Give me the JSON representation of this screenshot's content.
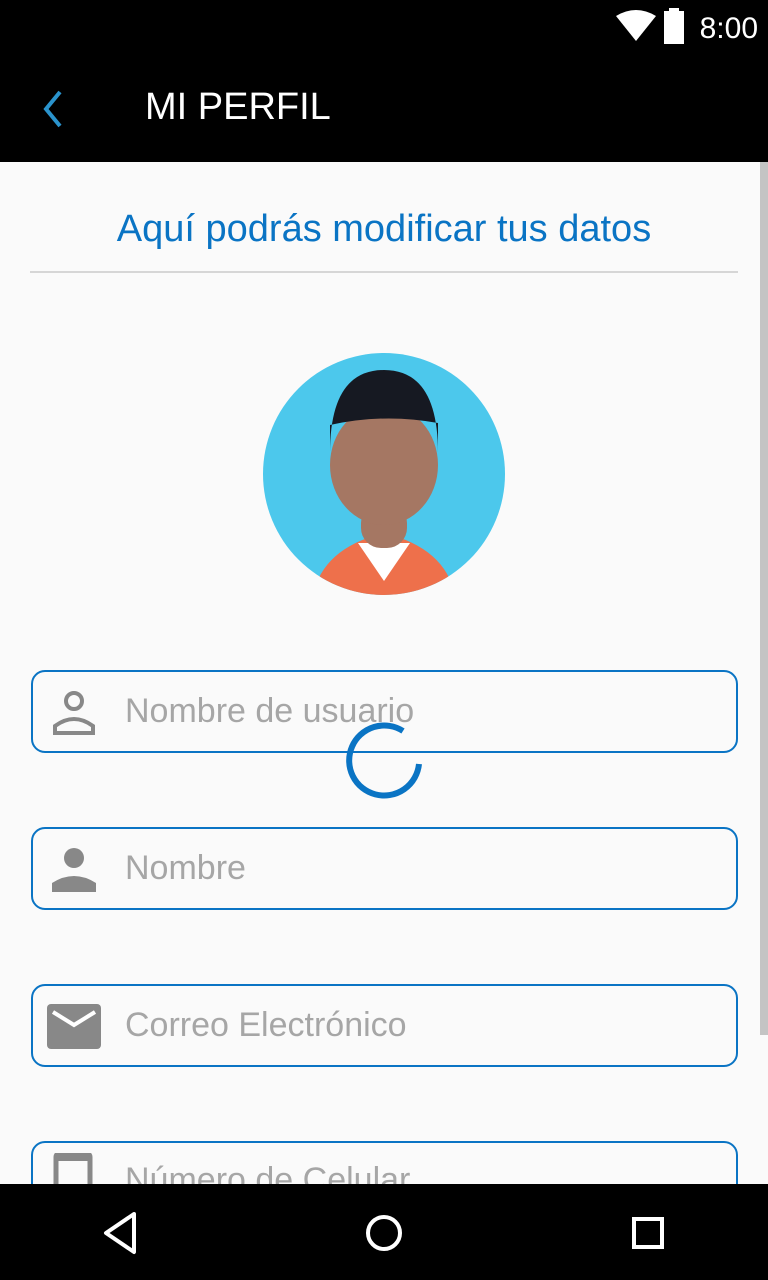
{
  "status_bar": {
    "time": "8:00",
    "icons": [
      "wifi-icon",
      "battery-icon"
    ]
  },
  "app_bar": {
    "title": "MI PERFIL",
    "back_icon": "chevron-left-icon"
  },
  "header": {
    "subtitle": "Aquí podrás modificar tus datos"
  },
  "form": {
    "fields": [
      {
        "placeholder": "Nombre de usuario",
        "value": "",
        "icon": "person-outline-icon"
      },
      {
        "placeholder": "Nombre",
        "value": "",
        "icon": "person-icon"
      },
      {
        "placeholder": "Correo Electrónico",
        "value": "",
        "icon": "email-icon"
      },
      {
        "placeholder": "Número de Celular",
        "value": "",
        "icon": "phone-icon"
      }
    ]
  },
  "loading": true,
  "colors": {
    "accent": "#0a74c4",
    "avatar_bg": "#4cc8ec",
    "icon": "#888888"
  }
}
